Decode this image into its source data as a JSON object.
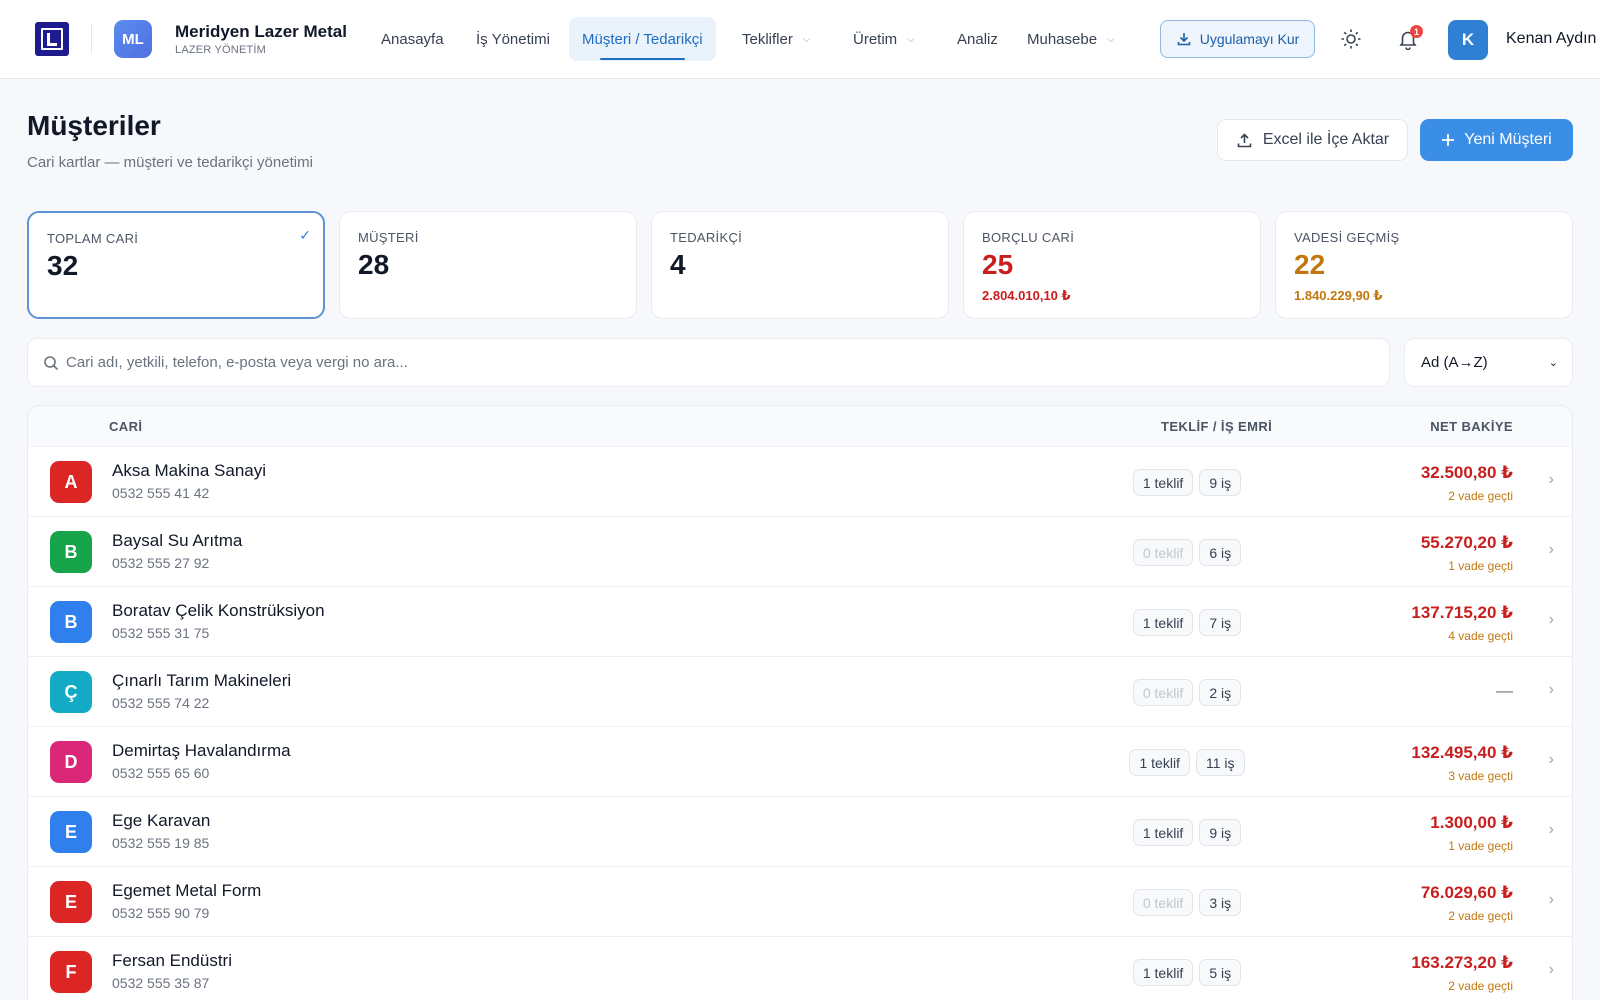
{
  "header": {
    "org_avatar": "ML",
    "org_name": "Meridyen Lazer Metal",
    "org_subtitle": "LAZER YÖNETİM",
    "nav": [
      {
        "label": "Anasayfa"
      },
      {
        "label": "İş Yönetimi"
      },
      {
        "label": "Müşteri / Tedarikçi"
      },
      {
        "label": "Teklifler"
      },
      {
        "label": "Üretim"
      },
      {
        "label": "Analiz"
      },
      {
        "label": "Muhasebe"
      }
    ],
    "install_label": "Uygulamayı Kur",
    "notification_count": "1",
    "user_initial": "K",
    "user_name": "Kenan Aydın"
  },
  "page": {
    "title": "Müşteriler",
    "subtitle": "Cari kartlar — müşteri ve tedarikçi yönetimi",
    "import_label": "Excel ile İçe Aktar",
    "new_label": "Yeni Müşteri"
  },
  "stats": [
    {
      "label": "TOPLAM CARİ",
      "value": "32",
      "amount": ""
    },
    {
      "label": "MÜŞTERİ",
      "value": "28",
      "amount": ""
    },
    {
      "label": "TEDARİKÇİ",
      "value": "4",
      "amount": ""
    },
    {
      "label": "BORÇLU CARİ",
      "value": "25",
      "amount": "2.804.010,10 ₺"
    },
    {
      "label": "VADESİ GEÇMİŞ",
      "value": "22",
      "amount": "1.840.229,90 ₺"
    }
  ],
  "search": {
    "placeholder": "Cari adı, yetkili, telefon, e-posta veya vergi no ara...",
    "sort_value": "Ad (A→Z)"
  },
  "table": {
    "headers": {
      "cari": "CARİ",
      "teklif": "TEKLİF / İŞ EMRİ",
      "bakiye": "NET BAKİYE"
    },
    "rows": [
      {
        "initial": "A",
        "color": "#dc2626",
        "name": "Aksa Makina Sanayi",
        "phone": "0532 555 41 42",
        "teklif": "1 teklif",
        "is": "9 iş",
        "balance": "32.500,80 ₺",
        "due": "2 vade geçti"
      },
      {
        "initial": "B",
        "color": "#16a34a",
        "name": "Baysal Su Arıtma",
        "phone": "0532 555 27 92",
        "teklif": "0 teklif",
        "is": "6 iş",
        "balance": "55.270,20 ₺",
        "due": "1 vade geçti"
      },
      {
        "initial": "B",
        "color": "#2f80ed",
        "name": "Boratav Çelik Konstrüksiyon",
        "phone": "0532 555 31 75",
        "teklif": "1 teklif",
        "is": "7 iş",
        "balance": "137.715,20 ₺",
        "due": "4 vade geçti"
      },
      {
        "initial": "Ç",
        "color": "#12aac4",
        "name": "Çınarlı Tarım Makineleri",
        "phone": "0532 555 74 22",
        "teklif": "0 teklif",
        "is": "2 iş",
        "balance": "—",
        "due": ""
      },
      {
        "initial": "D",
        "color": "#db2777",
        "name": "Demirtaş Havalandırma",
        "phone": "0532 555 65 60",
        "teklif": "1 teklif",
        "is": "11 iş",
        "balance": "132.495,40 ₺",
        "due": "3 vade geçti"
      },
      {
        "initial": "E",
        "color": "#2f80ed",
        "name": "Ege Karavan",
        "phone": "0532 555 19 85",
        "teklif": "1 teklif",
        "is": "9 iş",
        "balance": "1.300,00 ₺",
        "due": "1 vade geçti"
      },
      {
        "initial": "E",
        "color": "#dc2626",
        "name": "Egemet Metal Form",
        "phone": "0532 555 90 79",
        "teklif": "0 teklif",
        "is": "3 iş",
        "balance": "76.029,60 ₺",
        "due": "2 vade geçti"
      },
      {
        "initial": "F",
        "color": "#dc2626",
        "name": "Fersan Endüstri",
        "phone": "0532 555 35 87",
        "teklif": "1 teklif",
        "is": "5 iş",
        "balance": "163.273,20 ₺",
        "due": "2 vade geçti"
      }
    ]
  },
  "colors": {
    "accent": "#3a8ee6",
    "debt_red": "#c81e1e",
    "overdue_amber": "#c2780f"
  }
}
